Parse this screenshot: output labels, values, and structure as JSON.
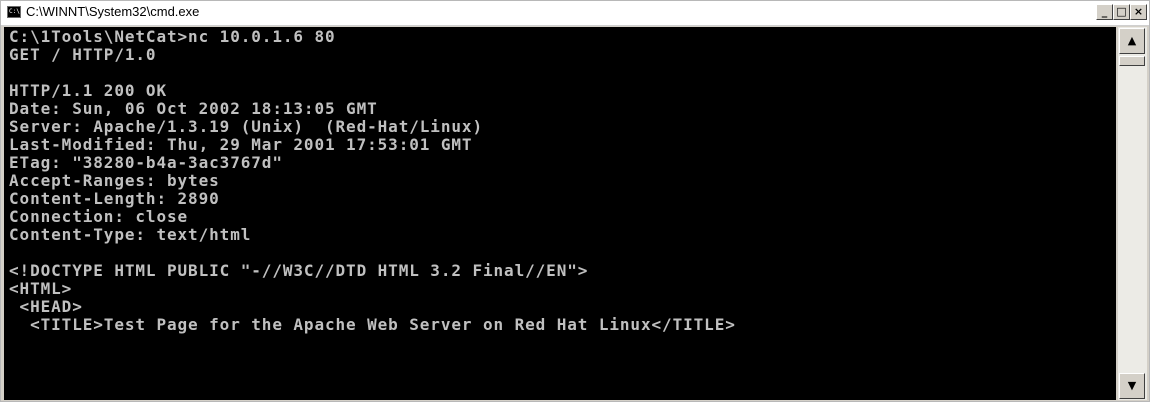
{
  "window": {
    "title": "C:\\WINNT\\System32\\cmd.exe",
    "icon": "cmd-icon",
    "icon_glyph": "C:\\",
    "buttons": {
      "minimize": "_",
      "maximize": "□",
      "close": "×"
    }
  },
  "console": {
    "lines": [
      "C:\\1Tools\\NetCat>nc 10.0.1.6 80",
      "GET / HTTP/1.0",
      "",
      "HTTP/1.1 200 OK",
      "Date: Sun, 06 Oct 2002 18:13:05 GMT",
      "Server: Apache/1.3.19 (Unix)  (Red-Hat/Linux)",
      "Last-Modified: Thu, 29 Mar 2001 17:53:01 GMT",
      "ETag: \"38280-b4a-3ac3767d\"",
      "Accept-Ranges: bytes",
      "Content-Length: 2890",
      "Connection: close",
      "Content-Type: text/html",
      "",
      "<!DOCTYPE HTML PUBLIC \"-//W3C//DTD HTML 3.2 Final//EN\">",
      "<HTML>",
      " <HEAD>",
      "  <TITLE>Test Page for the Apache Web Server on Red Hat Linux</TITLE>"
    ]
  },
  "scrollbar": {
    "up_arrow": "▲",
    "down_arrow": "▼"
  },
  "colors": {
    "console_background": "#000000",
    "console_text": "#c0c0c0",
    "chrome": "#d4d0c8"
  }
}
